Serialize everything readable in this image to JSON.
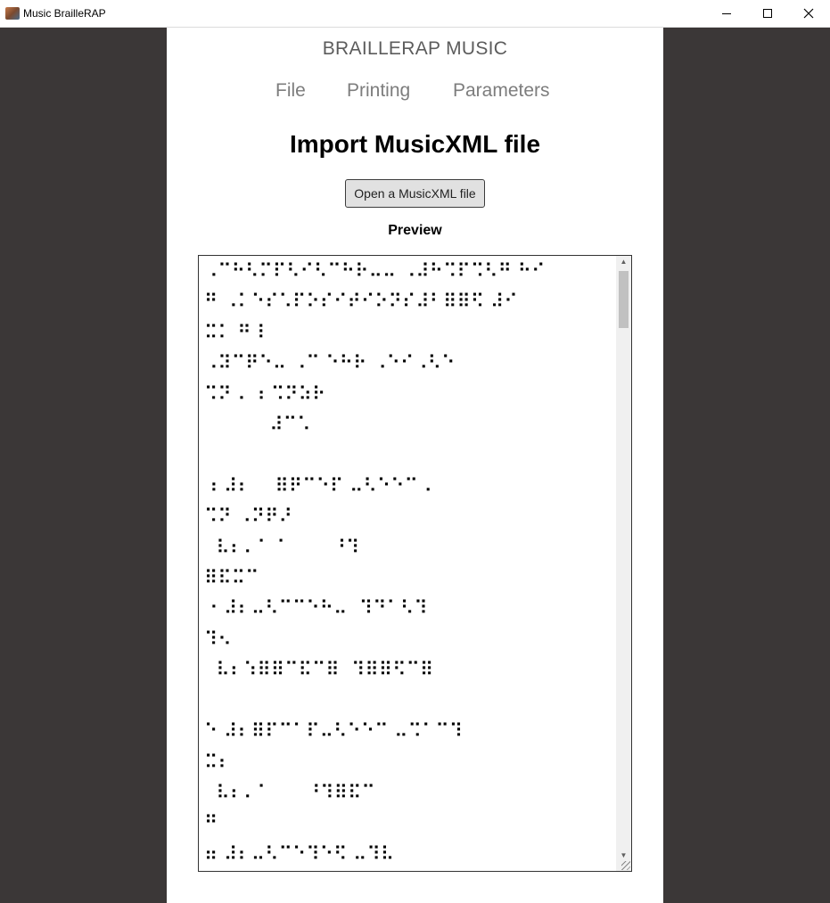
{
  "window": {
    "title": "Music BrailleRAP"
  },
  "app": {
    "brand": "BRAILLERAP MUSIC",
    "nav": {
      "file": "File",
      "printing": "Printing",
      "parameters": "Parameters"
    },
    "page_title": "Import MusicXML file",
    "open_button": "Open a MusicXML file",
    "preview_label": "Preview",
    "preview_text": "⠠⠉⠓⠣⠍⠏⠣⠊⠣⠉⠓⠗⠤⠤ ⠠⠼⠓⠩⠏⠩⠣⠛ ⠓⠊\n⠛ ⠠⠅⠑⠎⠡⠏⠕⠎⠊⠞⠊⠕⠝⠎⠼⠃⠿⠿⠫ ⠼⠊\n⠭⠅ ⠛⠸\n⠠⠽⠉⠟⠑⠤ ⠠⠉ ⠑⠓⠗ ⠠⠑⠊⠠⠣⠑\n⠩⠝ ⠄ ⠆⠩⠝⠵⠗\n           ⠼⠉⠡\n\n⠰ ⠼⠆    ⠿⠟⠉⠑⠏ ⠤⠣⠑⠑⠉ ⠄\n⠩⠝ ⠠⠝⠟⠜\n  ⠧⠆⠄⠁ ⠁       ⠘⠹\n⠿⠯⠭⠉\n⠐ ⠼⠆⠤⠣⠉⠉⠑⠓⠤  ⠹⠙⠁⠣⠹\n⠹⠢\n  ⠧⠆⠱⠿⠿⠉⠯⠉⠿  ⠹⠿⠿⠫⠉⠿\n\n⠑ ⠼⠆⠿⠏⠉⠁⠏⠤⠣⠑⠑⠉ ⠤⠩⠁⠉⠹\n⠭⠆\n  ⠧⠆⠄⠁      ⠘⠹⠿⠯⠉\n⠛\n⠶ ⠼⠆⠤⠣⠉⠑⠹⠑⠫ ⠤⠹⠧\n ⠗⠗⠗"
  }
}
